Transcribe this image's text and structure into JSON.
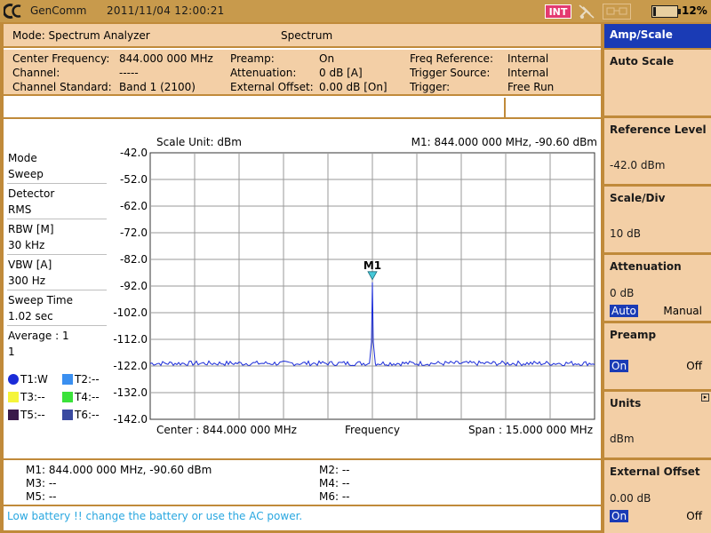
{
  "top_bar": {
    "brand": "GenComm",
    "datetime": "2011/11/04 12:00:21",
    "int_badge": "INT",
    "battery_pct": "12%",
    "battery_level": 0.12
  },
  "header": {
    "mode": "Mode: Spectrum Analyzer",
    "view_title": "Spectrum"
  },
  "params": {
    "center_frequency_label": "Center Frequency:",
    "center_frequency_value": "844.000 000 MHz",
    "channel_label": "Channel:",
    "channel_value": "-----",
    "channel_standard_label": "Channel Standard:",
    "channel_standard_value": "Band 1 (2100)",
    "preamp_label": "Preamp:",
    "preamp_value": "On",
    "attenuation_label": "Attenuation:",
    "attenuation_value": "0 dB  [A]",
    "external_offset_label": "External Offset:",
    "external_offset_value": "0.00 dB  [On]",
    "freq_reference_label": "Freq Reference:",
    "freq_reference_value": "Internal",
    "trigger_source_label": "Trigger Source:",
    "trigger_source_value": "Internal",
    "trigger_label": "Trigger:",
    "trigger_value": "Free Run"
  },
  "settings": [
    {
      "label": "Mode",
      "value": "Sweep"
    },
    {
      "label": "Detector",
      "value": "RMS"
    },
    {
      "label": "RBW [M]",
      "value": "30 kHz"
    },
    {
      "label": "VBW [A]",
      "value": "300 Hz"
    },
    {
      "label": "Sweep Time",
      "value": "1.02 sec"
    },
    {
      "label": "Average : 1",
      "value": "1"
    }
  ],
  "traces": [
    {
      "label": "T1:W",
      "color": "#1a2bd8"
    },
    {
      "label": "T2:--",
      "color": "#3a8ff0"
    },
    {
      "label": "T3:--",
      "color": "#f5f53a"
    },
    {
      "label": "T4:--",
      "color": "#3ae23a"
    },
    {
      "label": "T5:--",
      "color": "#3a1a4a"
    },
    {
      "label": "T6:--",
      "color": "#3a4aa0"
    }
  ],
  "chart_data": {
    "type": "line",
    "scale_unit": "Scale Unit: dBm",
    "marker_readout": "M1: 844.000 000 MHz, -90.60 dBm",
    "y_ticks": [
      "-42.0",
      "-52.0",
      "-62.0",
      "-72.0",
      "-82.0",
      "-92.0",
      "-102.0",
      "-112.0",
      "-122.0",
      "-132.0",
      "-142.0"
    ],
    "ylim": [
      -142,
      -42
    ],
    "x_center_label": "Center : 844.000 000 MHz",
    "x_axis_label": "Frequency",
    "x_span_label": "Span : 15.000 000 MHz",
    "center_mhz": 844.0,
    "span_mhz": 15.0,
    "noise_floor_dbm": -121,
    "series": [
      {
        "name": "T1:W",
        "x": [
          836.5,
          838.0,
          840.0,
          842.0,
          843.9,
          843.97,
          844.0,
          844.03,
          844.1,
          846.0,
          848.0,
          850.0,
          851.5
        ],
        "y": [
          -121,
          -121,
          -121,
          -121,
          -121,
          -113,
          -90.6,
          -113,
          -121,
          -121,
          -121,
          -121,
          -121
        ]
      }
    ],
    "marker": {
      "label": "M1",
      "x": 844.0,
      "y": -90.6
    }
  },
  "markers_table": {
    "m1": "M1: 844.000 000 MHz, -90.60 dBm",
    "m2": "M2: --",
    "m3": "M3: --",
    "m4": "M4: --",
    "m5": "M5: --",
    "m6": "M6: --"
  },
  "status_message": "Low battery !! change the battery or use the AC power.",
  "softkeys": {
    "header": "Amp/Scale",
    "auto_scale": "Auto Scale",
    "reference_level": {
      "title": "Reference Level",
      "value": "-42.0 dBm"
    },
    "scale_div": {
      "title": "Scale/Div",
      "value": "10 dB"
    },
    "attenuation": {
      "title": "Attenuation",
      "value": "0 dB",
      "opt_auto": "Auto",
      "opt_manual": "Manual"
    },
    "preamp": {
      "title": "Preamp",
      "opt_on": "On",
      "opt_off": "Off"
    },
    "units": {
      "title": "Units",
      "value": "dBm"
    },
    "external_offset": {
      "title": "External Offset",
      "value": "0.00 dB",
      "opt_on": "On",
      "opt_off": "Off"
    }
  },
  "colors": {
    "frame": "#c08a3a",
    "panel": "#f3cfa6",
    "selected": "#1a3bb5",
    "trace": "#1a2bd8",
    "marker": "#45c8d8",
    "status_text": "#29a7e0"
  }
}
